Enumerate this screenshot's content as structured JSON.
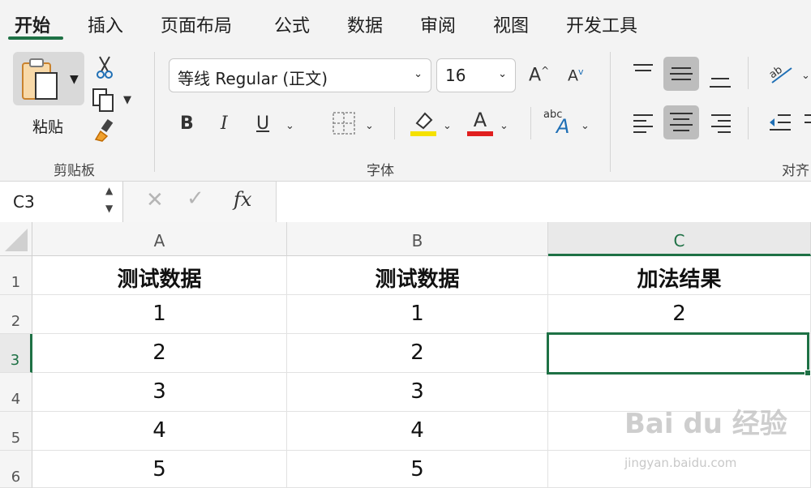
{
  "ribbon": {
    "tabs": [
      "开始",
      "插入",
      "页面布局",
      "公式",
      "数据",
      "审阅",
      "视图",
      "开发工具"
    ],
    "active_tab": "开始",
    "clipboard": {
      "paste_label": "粘贴",
      "group_label": "剪贴板"
    },
    "font": {
      "font_name": "等线 Regular (正文)",
      "font_size": "16",
      "group_label": "字体",
      "bold": "B",
      "italic": "I",
      "underline": "U",
      "grow": "A",
      "shrink": "A",
      "font_color_glyph": "A",
      "abc_glyph": "abc",
      "highlight_color": "#f5e100",
      "font_color": "#e01f1f"
    },
    "alignment": {
      "group_label": "对齐"
    }
  },
  "formula_bar": {
    "name_box": "C3",
    "fx": "fx",
    "formula": ""
  },
  "sheet": {
    "columns": [
      "A",
      "B",
      "C"
    ],
    "selected_column": "C",
    "rows": [
      {
        "num": "1",
        "cells": [
          "测试数据",
          "测试数据",
          "加法结果"
        ]
      },
      {
        "num": "2",
        "cells": [
          "1",
          "1",
          "2"
        ]
      },
      {
        "num": "3",
        "cells": [
          "2",
          "2",
          ""
        ]
      },
      {
        "num": "4",
        "cells": [
          "3",
          "3",
          ""
        ]
      },
      {
        "num": "5",
        "cells": [
          "4",
          "4",
          ""
        ]
      },
      {
        "num": "6",
        "cells": [
          "5",
          "5",
          ""
        ]
      }
    ],
    "active_cell": "C3"
  },
  "watermark": {
    "brand": "Bai du 经验",
    "url": "jingyan.baidu.com"
  },
  "colors": {
    "accent": "#1e7145"
  }
}
